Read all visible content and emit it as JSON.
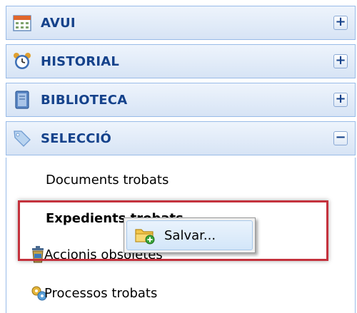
{
  "accordion": {
    "sections": [
      {
        "title": "AVUI",
        "icon": "calendar-icon",
        "toggle": "+"
      },
      {
        "title": "HISTORIAL",
        "icon": "alarm-clock-icon",
        "toggle": "+"
      },
      {
        "title": "BIBLIOTECA",
        "icon": "book-icon",
        "toggle": "+"
      },
      {
        "title": "SELECCIÓ",
        "icon": "tag-icon",
        "toggle": "−"
      }
    ],
    "seleccio_items": [
      {
        "label": "Documents trobats"
      },
      {
        "label": "Expedients trobats"
      },
      {
        "label": "Accionis obsoletes"
      },
      {
        "label": "Processos trobats"
      }
    ]
  },
  "context_menu": {
    "items": [
      {
        "label": "Salvar...",
        "icon": "folder-add-icon"
      }
    ]
  },
  "colors": {
    "header_text": "#15428b",
    "header_border": "#99bbe8",
    "highlight": "#c4323d"
  }
}
